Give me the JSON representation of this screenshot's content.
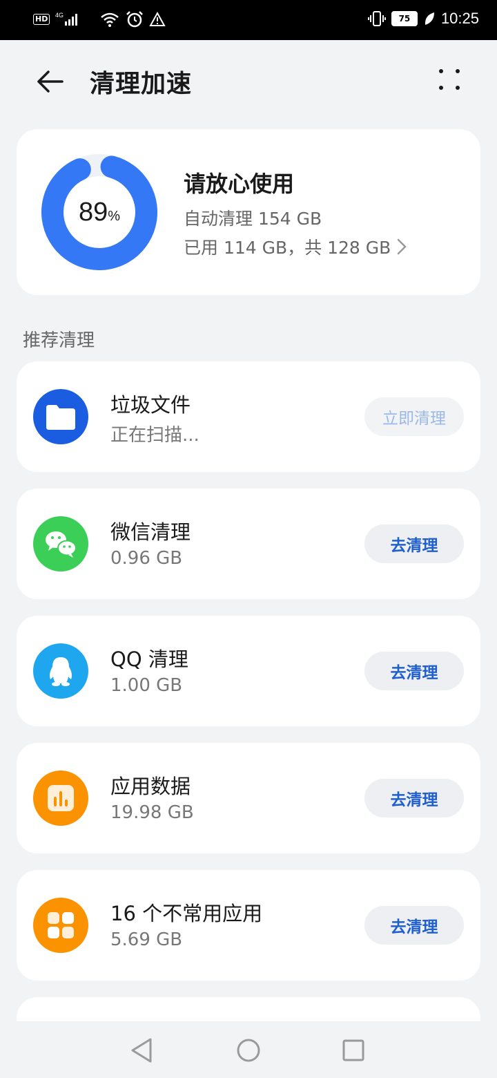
{
  "status_bar": {
    "left_icons": [
      "hd-icon",
      "4g-signal-icon",
      "wifi-icon",
      "alarm-icon",
      "warning-icon"
    ],
    "hd_label": "HD",
    "network_label": "4G",
    "battery": "75",
    "time": "10:25"
  },
  "header": {
    "title": "清理加速"
  },
  "storage": {
    "percent_value": "89",
    "percent_sign": "%",
    "percent_fraction": 0.89,
    "title": "请放心使用",
    "auto_clean": "自动清理 154 GB",
    "usage": "已用 114 GB，共 128 GB",
    "ring_color": "#3478f6"
  },
  "section": {
    "title": "推荐清理"
  },
  "items": [
    {
      "name": "垃圾文件",
      "sub": "正在扫描...",
      "button": "立即清理",
      "icon": "folder-icon",
      "color": "#1a5de0",
      "disabled": true
    },
    {
      "name": "微信清理",
      "sub": "0.96 GB",
      "button": "去清理",
      "icon": "wechat-icon",
      "color": "#3ccf57",
      "disabled": false
    },
    {
      "name": "QQ 清理",
      "sub": "1.00 GB",
      "button": "去清理",
      "icon": "qq-penguin-icon",
      "color": "#1ea7ee",
      "disabled": false
    },
    {
      "name": "应用数据",
      "sub": "19.98 GB",
      "button": "去清理",
      "icon": "bar-chart-icon",
      "color": "#fb9200",
      "disabled": false
    },
    {
      "name": "16 个不常用应用",
      "sub": "5.69 GB",
      "button": "去清理",
      "icon": "app-grid-icon",
      "color": "#fb9200",
      "disabled": false
    }
  ],
  "navbar": {
    "buttons": [
      "back-triangle-icon",
      "home-circle-icon",
      "recents-square-icon"
    ]
  }
}
